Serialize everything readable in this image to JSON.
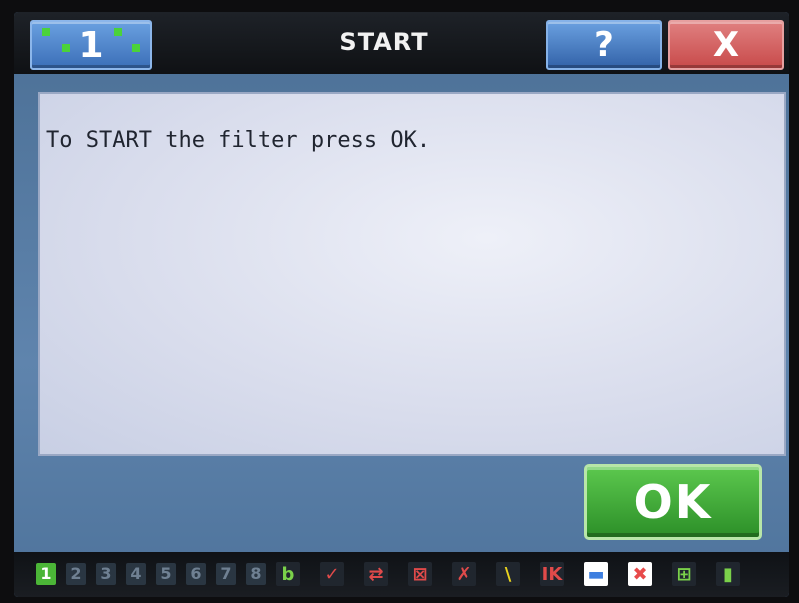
{
  "header": {
    "station_label": "1",
    "title": "START",
    "help_label": "?",
    "close_label": "X"
  },
  "panel": {
    "message": "To START the filter press OK."
  },
  "actions": {
    "ok_label": "OK"
  },
  "statusbar": {
    "numbers": [
      "1",
      "2",
      "3",
      "4",
      "5",
      "6",
      "7",
      "8"
    ],
    "active_number": "1",
    "icons": [
      {
        "name": "door-open-icon",
        "glyph": "b",
        "color": "#7ad14a"
      },
      {
        "name": "pump-off-icon",
        "glyph": "✓",
        "color": "#e04a4a"
      },
      {
        "name": "flow-off-icon",
        "glyph": "⇄",
        "color": "#e04a4a"
      },
      {
        "name": "filter-off-icon",
        "glyph": "⊠",
        "color": "#e04a4a"
      },
      {
        "name": "valve-off-icon",
        "glyph": "✗",
        "color": "#e04a4a"
      },
      {
        "name": "sensor-warning-icon",
        "glyph": "\\",
        "color": "#e8d21e"
      },
      {
        "name": "heater-icon",
        "glyph": "IK",
        "color": "#e04a4a"
      },
      {
        "name": "save-icon",
        "glyph": "▬",
        "color": "#3e7fe0"
      },
      {
        "name": "error-icon",
        "glyph": "✖",
        "color": "#e84a4a"
      },
      {
        "name": "grid-icon",
        "glyph": "⊞",
        "color": "#7ad14a"
      },
      {
        "name": "thermometer-icon",
        "glyph": "▮",
        "color": "#7ad14a"
      }
    ]
  }
}
